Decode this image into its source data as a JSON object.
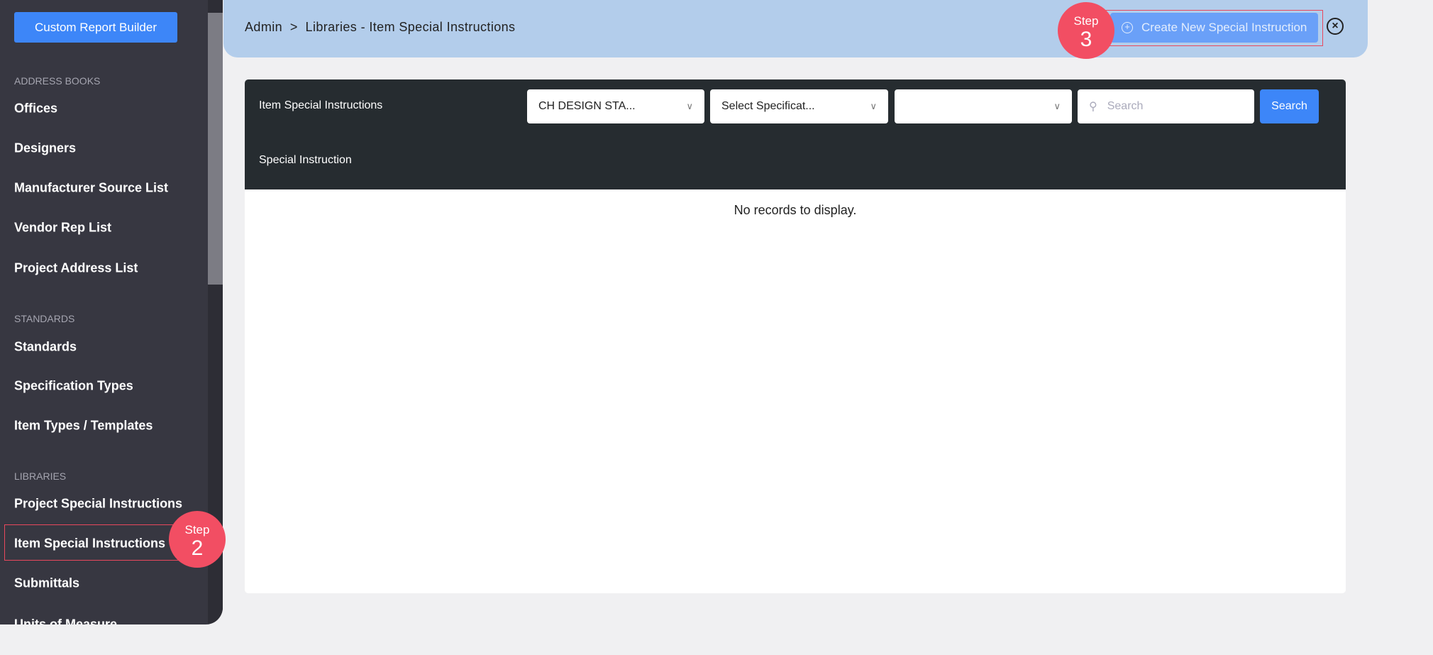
{
  "sidebar": {
    "custom_report_builder": "Custom Report Builder",
    "sections": [
      {
        "label": "ADDRESS BOOKS",
        "items": [
          "Offices",
          "Designers",
          "Manufacturer Source List",
          "Vendor Rep List",
          "Project Address List"
        ]
      },
      {
        "label": "STANDARDS",
        "items": [
          "Standards",
          "Specification Types",
          "Item Types / Templates"
        ]
      },
      {
        "label": "LIBRARIES",
        "items": [
          "Project Special Instructions",
          "Item Special Instructions",
          "Submittals",
          "Units of Measure"
        ]
      }
    ],
    "active_item": "Item Special Instructions"
  },
  "steps": {
    "step2": {
      "label": "Step",
      "number": "2"
    },
    "step3": {
      "label": "Step",
      "number": "3"
    }
  },
  "header": {
    "breadcrumb": "Admin  >  Libraries - Item Special Instructions",
    "create_button": "Create New Special Instruction"
  },
  "panel": {
    "title": "Item Special Instructions",
    "filters": [
      {
        "value": "CH DESIGN STA..."
      },
      {
        "value": "Select Specificat..."
      },
      {
        "value": ""
      }
    ],
    "search_placeholder": "Search",
    "search_button": "Search",
    "column": "Special Instruction",
    "empty_message": "No records to display."
  },
  "colors": {
    "accent": "#3d86f8",
    "step": "#f24e63",
    "header": "#b3cdeb",
    "sidebar": "#373741"
  }
}
